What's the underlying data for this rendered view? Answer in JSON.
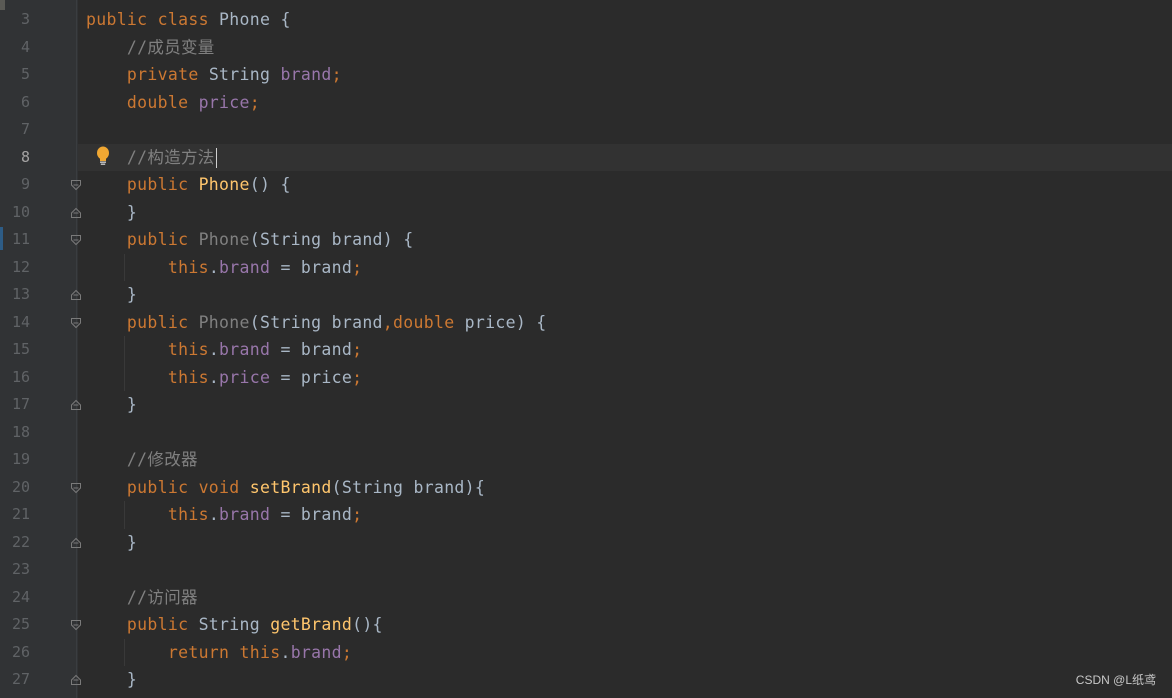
{
  "editor": {
    "current_line": "8",
    "lines": [
      {
        "num": "3",
        "segs": [
          [
            "kw",
            "public class "
          ],
          [
            "pl",
            "Phone {"
          ]
        ]
      },
      {
        "num": "4",
        "segs": [
          [
            "cm",
            "    //成员变量"
          ]
        ]
      },
      {
        "num": "5",
        "segs": [
          [
            "kw",
            "    private "
          ],
          [
            "pl",
            "String "
          ],
          [
            "fld",
            "brand"
          ],
          [
            "kw",
            ";"
          ]
        ]
      },
      {
        "num": "6",
        "segs": [
          [
            "kw",
            "    double "
          ],
          [
            "fld",
            "price"
          ],
          [
            "kw",
            ";"
          ]
        ]
      },
      {
        "num": "7",
        "segs": []
      },
      {
        "num": "8",
        "segs": [
          [
            "cm",
            "    //构造方法"
          ]
        ],
        "caret": true
      },
      {
        "num": "9",
        "segs": [
          [
            "kw",
            "    public "
          ],
          [
            "ctor",
            "Phone"
          ],
          [
            "pl",
            "() {"
          ]
        ],
        "fold": "open"
      },
      {
        "num": "10",
        "segs": [
          [
            "pl",
            "    }"
          ]
        ],
        "fold": "close"
      },
      {
        "num": "11",
        "segs": [
          [
            "kw",
            "    public "
          ],
          [
            "ctor-unused",
            "Phone"
          ],
          [
            "pl",
            "(String brand) {"
          ]
        ],
        "fold": "open"
      },
      {
        "num": "12",
        "segs": [
          [
            "kw",
            "        this"
          ],
          [
            "pl",
            "."
          ],
          [
            "fld",
            "brand"
          ],
          [
            "pl",
            " = brand"
          ],
          [
            "kw",
            ";"
          ]
        ]
      },
      {
        "num": "13",
        "segs": [
          [
            "pl",
            "    }"
          ]
        ],
        "fold": "close"
      },
      {
        "num": "14",
        "segs": [
          [
            "kw",
            "    public "
          ],
          [
            "ctor-unused",
            "Phone"
          ],
          [
            "pl",
            "(String brand"
          ],
          [
            "kw",
            ",double "
          ],
          [
            "pl",
            "price) {"
          ]
        ],
        "fold": "open"
      },
      {
        "num": "15",
        "segs": [
          [
            "kw",
            "        this"
          ],
          [
            "pl",
            "."
          ],
          [
            "fld",
            "brand"
          ],
          [
            "pl",
            " = brand"
          ],
          [
            "kw",
            ";"
          ]
        ]
      },
      {
        "num": "16",
        "segs": [
          [
            "kw",
            "        this"
          ],
          [
            "pl",
            "."
          ],
          [
            "fld",
            "price"
          ],
          [
            "pl",
            " = price"
          ],
          [
            "kw",
            ";"
          ]
        ]
      },
      {
        "num": "17",
        "segs": [
          [
            "pl",
            "    }"
          ]
        ],
        "fold": "close"
      },
      {
        "num": "18",
        "segs": []
      },
      {
        "num": "19",
        "segs": [
          [
            "cm",
            "    //修改器"
          ]
        ]
      },
      {
        "num": "20",
        "segs": [
          [
            "kw",
            "    public void "
          ],
          [
            "fn",
            "setBrand"
          ],
          [
            "pl",
            "(String brand){"
          ]
        ],
        "fold": "open"
      },
      {
        "num": "21",
        "segs": [
          [
            "kw",
            "        this"
          ],
          [
            "pl",
            "."
          ],
          [
            "fld",
            "brand"
          ],
          [
            "pl",
            " = brand"
          ],
          [
            "kw",
            ";"
          ]
        ]
      },
      {
        "num": "22",
        "segs": [
          [
            "pl",
            "    }"
          ]
        ],
        "fold": "close"
      },
      {
        "num": "23",
        "segs": []
      },
      {
        "num": "24",
        "segs": [
          [
            "cm",
            "    //访问器"
          ]
        ]
      },
      {
        "num": "25",
        "segs": [
          [
            "kw",
            "    public "
          ],
          [
            "pl",
            "String "
          ],
          [
            "fn",
            "getBrand"
          ],
          [
            "pl",
            "(){"
          ]
        ],
        "fold": "open"
      },
      {
        "num": "26",
        "segs": [
          [
            "kw",
            "        return this"
          ],
          [
            "pl",
            "."
          ],
          [
            "fld",
            "brand"
          ],
          [
            "kw",
            ";"
          ]
        ]
      },
      {
        "num": "27",
        "segs": [
          [
            "pl",
            "    }"
          ]
        ],
        "fold": "close"
      }
    ]
  },
  "watermark": "CSDN @L纸鸢",
  "colors": {
    "background": "#2b2b2b",
    "gutter": "#313335",
    "keyword": "#cc7832",
    "field": "#9876aa",
    "method": "#ffc66d",
    "comment": "#808080",
    "plain": "#a9b7c6",
    "bulb": "#f0a732"
  },
  "icons": {
    "intention": "lightbulb-icon",
    "fold_open": "fold-open-icon",
    "fold_close": "fold-close-icon"
  }
}
